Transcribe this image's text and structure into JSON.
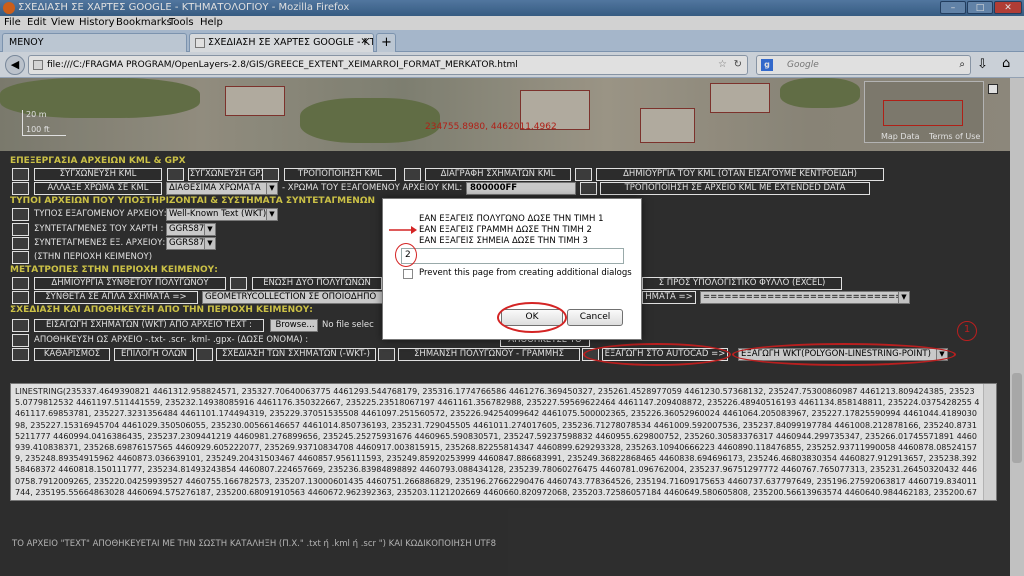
{
  "window": {
    "title": "ΣΧΕΔΙΑΣΗ ΣΕ ΧΑΡΤΕΣ GOOGLE - ΚΤΗΜΑΤΟΛΟΓΙΟΥ - Mozilla Firefox"
  },
  "menu": [
    "File",
    "Edit",
    "View",
    "History",
    "Bookmarks",
    "Tools",
    "Help"
  ],
  "tabs": [
    {
      "label": "ΜΕΝΟΥ"
    },
    {
      "label": "ΣΧΕΔΙΑΣΗ ΣΕ ΧΑΡΤΕΣ GOOGLE - ΚΤΗ..."
    }
  ],
  "url": "file:///C:/FRAGMA PROGRAM/OpenLayers-2.8/GIS/GREECE_EXTENT_XEIMARROI_FORMAT_MERKATOR.html",
  "search": {
    "placeholder": "Google"
  },
  "map": {
    "coords": "234755.8980, 4462011.4962",
    "scale_m": "20 m",
    "scale_ft": "100 ft",
    "overview_links": [
      "Map Data",
      "Terms of Use"
    ]
  },
  "sections": {
    "kml": "ΕΠΕΞΕΡΓΑΣΙΑ ΑΡΧΕΙΩΝ KML & GPX",
    "types": "ΤΥΠΟΙ ΑΡΧΕΙΩΝ ΠΟΥ ΥΠΟΣΤΗΡΙΖΟΝΤΑΙ & ΣΥΣΤΗΜΑΤΑ ΣΥΝΤΕΤΑΓΜΕΝΩΝ",
    "conv": "ΜΕΤΑΤΡΟΠΕΣ ΣΤΗΝ ΠΕΡΙΟΧΗ ΚΕΙΜΕΝΟΥ:",
    "draw": "ΣΧΕΔΙΑΣΗ ΚΑΙ ΑΠΟΘΗΚΕΥΣΗ ΑΠΟ ΤΗΝ ΠΕΡΙΟΧΗ ΚΕΙΜΕΝΟΥ:"
  },
  "kml": {
    "btn_merge_kml": "ΣΥΓΧΩΝΕΥΣΗ KML",
    "btn_merge_gpx": "ΣΥΓΧΩΝΕΥΣΗ GPX",
    "btn_edit_kml": "ΤΡΟΠΟΠΟΙΗΣΗ KML",
    "btn_delete_shapes": "ΔΙΑΓΡΑΦΗ ΣΧΗΜΑΤΩΝ KML",
    "btn_create_kml": "ΔΗΜΙΟΥΡΓΙΑ ΤΟΥ KML (ΟΤΑΝ ΕΙΣΑΓΟΥΜΕ ΚΕΝΤΡΟΕΙΔΗ)",
    "btn_change_color": "ΑΛΛΑΞΕ ΧΡΩΜΑ ΣΕ KML",
    "color_select": "ΔΙΑΘΕΣΙΜΑ ΧΡΩΜΑΤΑ",
    "color_label": "- ΧΡΩΜΑ ΤΟΥ ΕΞΑΓΟΜΕΝΟΥ ΑΡΧΕΙΟΥ KML:",
    "color_value": "800000FF",
    "btn_extended": "ΤΡΟΠΟΠΟΙΗΣΗ ΣΕ ΑΡΧΕΙΟ KML ME EXTENDED DATA"
  },
  "types": {
    "export_type_label": "ΤΥΠΟΣ ΕΞΑΓΟΜΕΝΟΥ ΑΡΧΕΙΟΥ:",
    "export_type_value": "Well-Known Text (WKT)",
    "map_coords_label": "ΣΥΝΤΕΤΑΓΜΕΝΕΣ ΤΟΥ ΧΑΡΤΗ :",
    "map_coords_value": "GGRS87",
    "file_coords_label": "ΣΥΝΤΕΤΑΓΜΕΝΕΣ ΕΞ. ΑΡΧΕΙΟΥ:",
    "file_coords_value": "GGRS87",
    "text_area_label": "(ΣΤΗΝ ΠΕΡΙΟΧΗ ΚΕΙΜΕΝΟΥ)"
  },
  "conv": {
    "btn_create_poly": "ΔΗΜΙΟΥΡΓΙΑ ΣΥΝΘΕΤΟΥ ΠΟΛΥΓΩΝΟΥ",
    "btn_join_poly": "ΕΝΩΣΗ ΔΥΟ ΠΟΛΥΓΩΝΩΝ",
    "btn_excel": "Σ ΠΡΟΣ ΥΠΟΛΟΓΙΣΤΙΚΟ ΦΥΛΛΟ (EXCEL)",
    "btn_complex": "ΣΥΝΘΕΤΑ ΣΕ ΑΠΛΑ ΣΧΗΜΑΤΑ =>",
    "geom_select": "GEOMETRYCOLLECTION ΣΕ ΟΠΟΙΟΔΗΠΟ",
    "btn_shapes": "ΗΜΑΤΑ =>",
    "shapes_select": "================================"
  },
  "draw": {
    "btn_import_wkt": "ΕΙΣΑΓΩΓΗ ΣΧΗΜΑΤΩΝ (WKT) ΑΠΟ ΑΡΧΕΙΟ TEXT :",
    "browse": "Browse...",
    "no_file": "No file selec",
    "save_label": "ΑΠΟΘΗΚΕΥΣΗ ΩΣ ΑΡΧΕΙΟ -.txt- .scr- .kml- .gpx- (ΔΩΣΕ ΟΝΟΜΑ) :",
    "btn_save_text": "ΑΠΟΘΗΚΕΥΣΕ ΤΟ",
    "btn_clear": "ΚΑΘΑΡΙΣΜΟΣ",
    "btn_select_all": "ΕΠΙΛΟΓΗ ΟΛΩΝ",
    "btn_draw": "ΣΧΕΔΙΑΣΗ ΤΩΝ ΣΧΗΜΑΤΩΝ (-WKT-)",
    "btn_mark": "ΣΗΜΑΝΣΗ ΠΟΛΥΓΩΝΟΥ - ΓΡΑΜΜΗΣ",
    "btn_autocad": "ΕΞΑΓΩΓΗ ΣΤΟ AUTOCAD =>",
    "wkt_select": "ΕΞΑΓΩΓΗ WKT(POLYGON-LINESTRING-POINT)"
  },
  "textarea": "LINESTRING(235337.4649390821 4461312.958824571, 235327.70640063775 4461293.544768179, 235316.1774766586 4461276.369450327, 235261.4528977059 4461230.57368132, 235247.75300860987 4461213.809424385, 235235.0779812532 4461197.511441559, 235232.14938085916 4461176.350322667, 235225.23518067197 4461161.356782988, 235227.59569622464 4461147.209408872, 235226.48940516193 4461134.858148811, 235224.0375428255 4461117.69853781, 235227.3231356484 4461101.174494319, 235229.37051535508 4461097.251560572, 235226.94254099642 4461075.500002365, 235226.36052960024 4461064.205083967, 235227.17825590994 4461044.418903098, 235227.15316945704 4461029.350506055, 235230.00566146657 4461014.850736193, 235231.729045505 4461011.274017605, 235236.71278078534 4461009.592007536, 235237.84099197784 4461008.212878166, 235240.87315211777 4460994.0416386435, 235237.2309441219 4460981.276899656, 235245.25275931676 4460965.590830571, 235247.59237598832 4460955.629800752, 235260.30583376317 4460944.299735347, 235266.01745571891 4460939.410838371, 235268.69876157565 4460929.605222077, 235269.93710834708 4460917.003815915, 235268.82255814347 4460899.629293328, 235263.10940666223 4460890.118476855, 235252.93711990058 4460878.085241579, 235248.89354915962 4460873.036639101, 235249.20431503467 4460857.956111593, 235249.85920253999 4460847.886683991, 235249.36822868465 4460838.694696173, 235246.46803830354 4460827.912913657, 235238.39258468372 4460818.150111777, 235234.81493243854 4460807.224657669, 235236.83984898892 4460793.088434128, 235239.78060276475 4460781.096762004, 235237.96751297772 4460767.765077313, 235231.26450320432 4460758.7912009265, 235220.04259939527 4460755.166782573, 235207.13000601435 4460751.266886829, 235196.27662290476 4460743.778364526, 235194.71609175653 4460737.637797649, 235196.27592063817 4460719.834011744, 235195.55664863028 4460694.575276187, 235200.68091910563 4460672.962392363, 235203.1121202669 4460660.820972068, 235203.72586057184 4460649.580605808, 235200.56613963574 4460640.984462183, 235200.67013886388 4460629.594521684, 235198.23008406544 4460612.766229875, 235192.32028025684 4460592.882239386, 235189.7229700231 4460585.940828642, 235186.44819357496 4460578.855675868, 235192.92003240273 4460569.468034754, 235194.5698974096 4460560.939457647, 235198.6649336511 4460552.742000227, 235221.75852229 4460549.773920528, 235219.777165113 4460522.117416273, 235208.5093565524 4460511.226402315, 235070.40239439624 4460465.5725005",
  "footer": "ΤΟ ΑΡΧΕΙΟ \"TEXT\" ΑΠΟΘΗΚΕΥΕΤΑΙ ΜΕ ΤΗΝ ΣΩΣΤΗ ΚΑΤΑΛΗΞΗ (Π.Χ.\" .txt ή .kml ή .scr \") ΚΑΙ ΚΩΔΙΚΟΠΟΙΗΣΗ UTF8",
  "dialog": {
    "lines": [
      "ΕΑΝ ΕΞΑΓΕΙΣ ΠΟΛΥΓΩΝΟ ΔΩΣΕ ΤΗΝ ΤΙΜΗ 1",
      "ΕΑΝ ΕΞΑΓΕΙΣ ΓΡΑΜΜΗ ΔΩΣΕ ΤΗΝ ΤΙΜΗ 2",
      "ΕΑΝ ΕΞΑΓΕΙΣ ΣΗΜΕΙΑ ΔΩΣΕ ΤΗΝ ΤΙΜΗ 3"
    ],
    "input_value": "2",
    "checkbox_label": "Prevent this page from creating additional dialogs",
    "ok": "OK",
    "cancel": "Cancel"
  },
  "annotation": {
    "number": "1"
  }
}
